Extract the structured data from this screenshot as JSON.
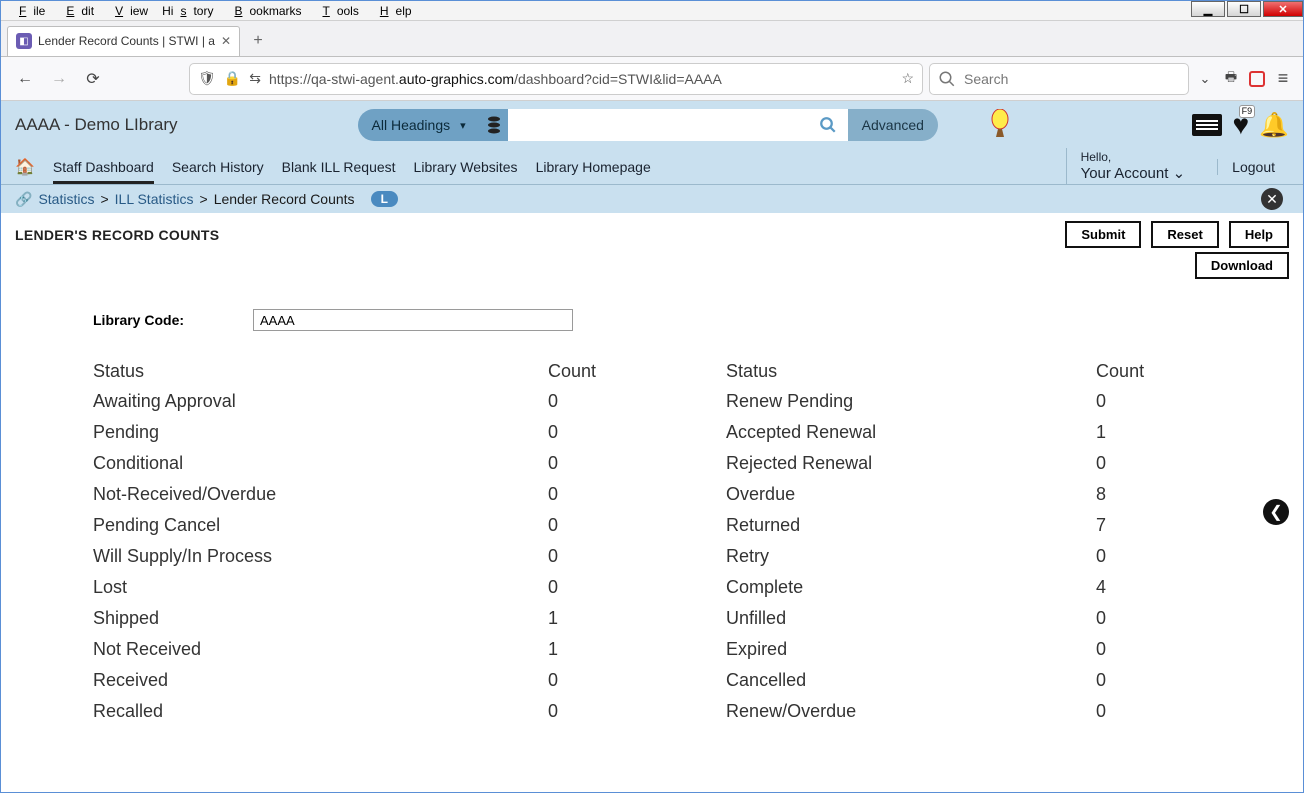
{
  "os_menu": [
    "File",
    "Edit",
    "View",
    "History",
    "Bookmarks",
    "Tools",
    "Help"
  ],
  "tab": {
    "title": "Lender Record Counts | STWI | a"
  },
  "url": {
    "prefix": "https://qa-stwi-agent.",
    "domain": "auto-graphics.com",
    "path": "/dashboard?cid=STWI&lid=AAAA"
  },
  "search_placeholder": "Search",
  "library_name": "AAAA - Demo LIbrary",
  "dropdown": "All Headings",
  "advanced": "Advanced",
  "nav": {
    "home_icon": "home",
    "items": [
      "Staff Dashboard",
      "Search History",
      "Blank ILL Request",
      "Library Websites",
      "Library Homepage"
    ]
  },
  "account": {
    "hello": "Hello,",
    "label": "Your Account"
  },
  "logout": "Logout",
  "breadcrumb": {
    "root": "Statistics",
    "mid": "ILL Statistics",
    "leaf": "Lender Record Counts",
    "badge": "L"
  },
  "page_title": "LENDER'S RECORD COUNTS",
  "buttons": {
    "submit": "Submit",
    "reset": "Reset",
    "help": "Help",
    "download": "Download"
  },
  "form": {
    "label": "Library Code:",
    "value": "AAAA"
  },
  "headers": {
    "status": "Status",
    "count": "Count"
  },
  "left": [
    {
      "s": "Awaiting Approval",
      "c": "0"
    },
    {
      "s": "Pending",
      "c": "0"
    },
    {
      "s": "Conditional",
      "c": "0"
    },
    {
      "s": "Not-Received/Overdue",
      "c": "0"
    },
    {
      "s": "Pending Cancel",
      "c": "0"
    },
    {
      "s": "Will Supply/In Process",
      "c": "0"
    },
    {
      "s": "Lost",
      "c": "0"
    },
    {
      "s": "Shipped",
      "c": "1"
    },
    {
      "s": "Not Received",
      "c": "1"
    },
    {
      "s": "Received",
      "c": "0"
    },
    {
      "s": "Recalled",
      "c": "0"
    }
  ],
  "right": [
    {
      "s": "Renew Pending",
      "c": "0"
    },
    {
      "s": "Accepted Renewal",
      "c": "1"
    },
    {
      "s": "Rejected Renewal",
      "c": "0"
    },
    {
      "s": "Overdue",
      "c": "8"
    },
    {
      "s": "Returned",
      "c": "7"
    },
    {
      "s": "Retry",
      "c": "0"
    },
    {
      "s": "Complete",
      "c": "4"
    },
    {
      "s": "Unfilled",
      "c": "0"
    },
    {
      "s": "Expired",
      "c": "0"
    },
    {
      "s": "Cancelled",
      "c": "0"
    },
    {
      "s": "Renew/Overdue",
      "c": "0"
    }
  ],
  "heart_badge": "F9"
}
